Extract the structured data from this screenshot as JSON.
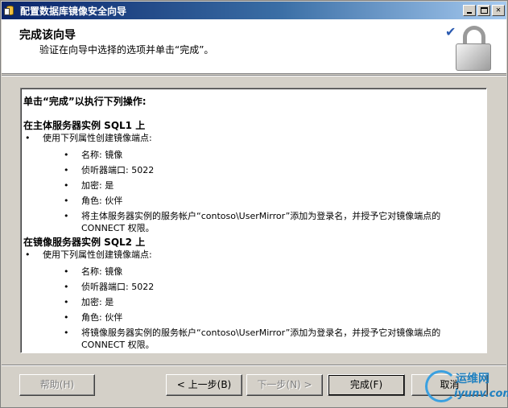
{
  "window": {
    "title": "配置数据库镜像安全向导"
  },
  "header": {
    "title": "完成该向导",
    "subtitle": "验证在向导中选择的选项并单击“完成”。"
  },
  "content": {
    "summary_heading": "单击“完成”以执行下列操作:",
    "sections": [
      {
        "heading": "在主体服务器实例 SQL1 上",
        "bullet": "使用下列属性创建镜像端点:",
        "items": [
          "名称: 镜像",
          "侦听器端口: 5022",
          "加密: 是",
          "角色: 伙伴",
          "将主体服务器实例的服务帐户“contoso\\UserMirror”添加为登录名，并授予它对镜像端点的 CONNECT 权限。"
        ]
      },
      {
        "heading": "在镜像服务器实例 SQL2 上",
        "bullet": "使用下列属性创建镜像端点:",
        "items": [
          "名称: 镜像",
          "侦听器端口: 5022",
          "加密: 是",
          "角色: 伙伴",
          "将镜像服务器实例的服务帐户“contoso\\UserMirror”添加为登录名，并授予它对镜像端点的 CONNECT 权限。"
        ]
      }
    ]
  },
  "buttons": {
    "help": "帮助(H)",
    "prev": "< 上一步(B)",
    "next": "下一步(N) >",
    "finish": "完成(F)",
    "cancel": "取消"
  },
  "watermark": {
    "line1": "运维网",
    "line2": "iyunv.com"
  }
}
